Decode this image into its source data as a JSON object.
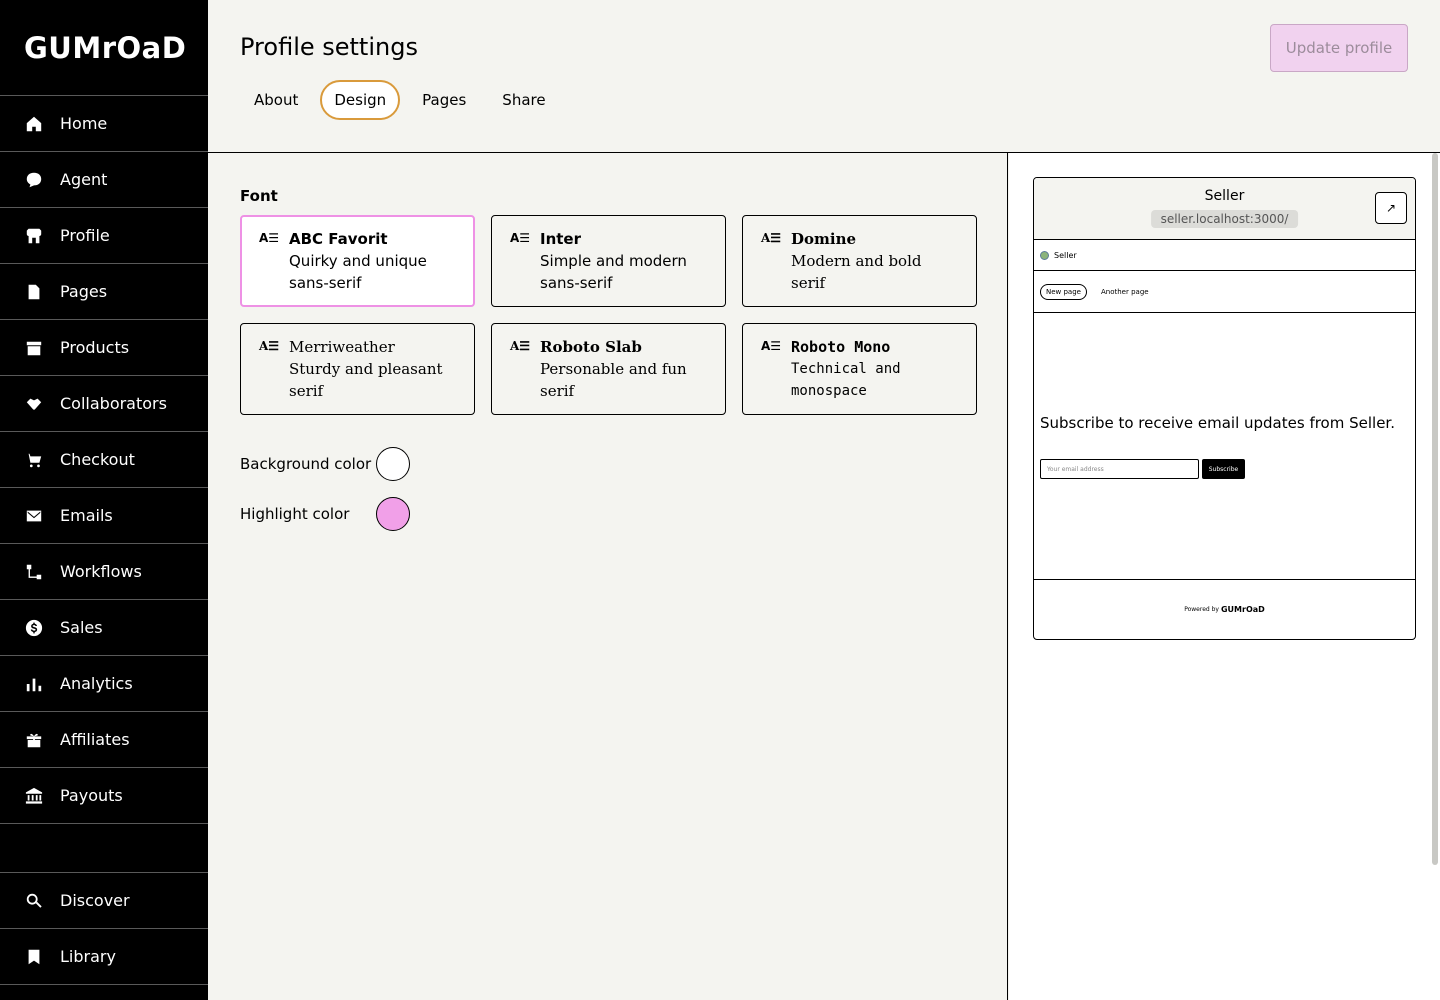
{
  "sidebar": {
    "logo": "GUMrOaD",
    "items": [
      {
        "label": "Home",
        "icon": "home-icon"
      },
      {
        "label": "Agent",
        "icon": "chat-icon"
      },
      {
        "label": "Profile",
        "icon": "shop-icon"
      },
      {
        "label": "Pages",
        "icon": "document-icon"
      },
      {
        "label": "Products",
        "icon": "archive-icon"
      },
      {
        "label": "Collaborators",
        "icon": "handshake-icon"
      },
      {
        "label": "Checkout",
        "icon": "cart-icon"
      },
      {
        "label": "Emails",
        "icon": "envelope-icon"
      },
      {
        "label": "Workflows",
        "icon": "workflow-icon"
      },
      {
        "label": "Sales",
        "icon": "dollar-icon"
      },
      {
        "label": "Analytics",
        "icon": "bar-chart-icon"
      },
      {
        "label": "Affiliates",
        "icon": "gift-icon"
      },
      {
        "label": "Payouts",
        "icon": "bank-icon"
      }
    ],
    "bottom_items": [
      {
        "label": "Discover",
        "icon": "search-icon"
      },
      {
        "label": "Library",
        "icon": "bookmark-icon"
      }
    ]
  },
  "header": {
    "title": "Profile settings",
    "update_label": "Update profile",
    "tabs": [
      {
        "label": "About"
      },
      {
        "label": "Design"
      },
      {
        "label": "Pages"
      },
      {
        "label": "Share"
      }
    ],
    "active_tab": "Design"
  },
  "design": {
    "font_label": "Font",
    "fonts": [
      {
        "name": "ABC Favorit",
        "desc1": "Quirky and unique",
        "desc2": "sans-serif"
      },
      {
        "name": "Inter",
        "desc1": "Simple and modern",
        "desc2": "sans-serif"
      },
      {
        "name": "Domine",
        "desc1": "Modern and bold",
        "desc2": "serif"
      },
      {
        "name": "Merriweather",
        "desc1": "Sturdy and pleasant",
        "desc2": "serif"
      },
      {
        "name": "Roboto Slab",
        "desc1": "Personable and fun",
        "desc2": "serif"
      },
      {
        "name": "Roboto Mono",
        "desc1": "Technical and",
        "desc2": "monospace"
      }
    ],
    "font_icon": "A☰",
    "selected_font": "ABC Favorit",
    "background_color_label": "Background color",
    "background_color": "#ffffff",
    "highlight_color_label": "Highlight color",
    "highlight_color": "#f1a0e8"
  },
  "preview": {
    "title": "Seller",
    "url": "seller.localhost:3000/",
    "open_icon": "↗",
    "seller_name": "Seller",
    "tabs": [
      {
        "label": "New page"
      },
      {
        "label": "Another page"
      }
    ],
    "subscribe_text": "Subscribe to receive email updates from Seller.",
    "email_placeholder": "Your email address",
    "subscribe_button": "Subscribe",
    "powered_by": "Powered by",
    "powered_brand": "GUMrOaD"
  },
  "colors": {
    "accent_pink": "#ee91e5",
    "tab_outline": "#d99a3b",
    "update_button_bg": "#f1d2ef"
  }
}
